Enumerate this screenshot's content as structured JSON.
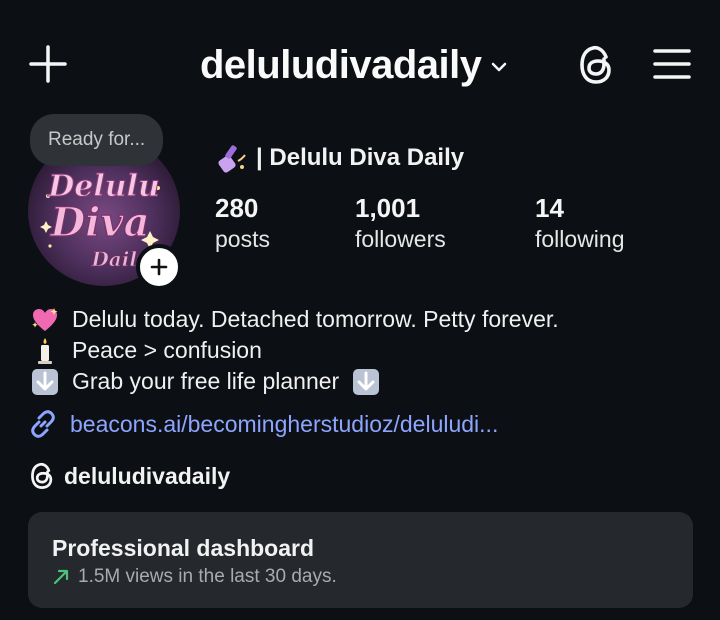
{
  "header": {
    "username": "deluludivadaily",
    "icons": [
      "plus-icon",
      "chevron-down-icon",
      "threads-icon",
      "hamburger-menu-icon"
    ]
  },
  "profile": {
    "note": "Ready for...",
    "display_name": "| Delulu Diva Daily",
    "stats": [
      {
        "value": "280",
        "label": "posts"
      },
      {
        "value": "1,001",
        "label": "followers"
      },
      {
        "value": "14",
        "label": "following"
      }
    ],
    "avatar_text": "Delulu Diva Daily"
  },
  "bio": {
    "lines": [
      {
        "icon": "sparkling-heart-icon",
        "text": "Delulu today. Detached tomorrow. Petty forever."
      },
      {
        "icon": "candle-icon",
        "text": "Peace > confusion"
      },
      {
        "icon": "down-arrow-icon",
        "text": "Grab your free life planner"
      }
    ],
    "link": "beacons.ai/becomingherstudioz/deluludi..."
  },
  "threads": {
    "handle": "deluludivadaily"
  },
  "dashboard": {
    "title": "Professional dashboard",
    "subtitle": "1.5M views in the last 30 days.",
    "trend_color": "#4cc27a"
  },
  "colors": {
    "background": "#0c0f14",
    "link": "#8ea5ff",
    "card": "#25282d"
  }
}
